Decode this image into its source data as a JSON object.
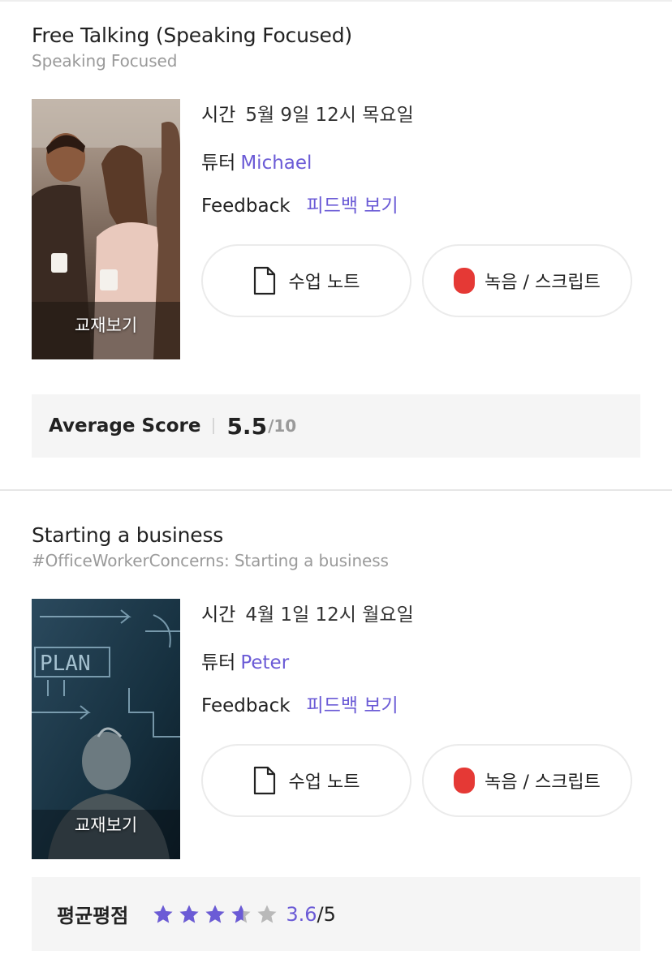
{
  "lessons": [
    {
      "title": "Free Talking (Speaking Focused)",
      "subtitle": "Speaking Focused",
      "thumb_label": "교재보기",
      "time_key": "시간",
      "time_value": "5월  9일 12시 목요일",
      "tutor_key": "튜터",
      "tutor_name": "Michael",
      "feedback_key": "Feedback",
      "feedback_link": "피드백 보기",
      "notes_button": "수업 노트",
      "recording_button": "녹음 / 스크립트",
      "score_label": "Average Score",
      "score_value": "5.5",
      "score_max": "/10"
    },
    {
      "title": "Starting a business",
      "subtitle": "#OfficeWorkerConcerns: Starting a business",
      "thumb_label": "교재보기",
      "time_key": "시간",
      "time_value": "4월  1일 12시 월요일",
      "tutor_key": "튜터",
      "tutor_name": "Peter",
      "feedback_key": "Feedback",
      "feedback_link": "피드백 보기",
      "notes_button": "수업 노트",
      "recording_button": "녹음 / 스크립트",
      "rating_label": "평균평점",
      "rating_value": "3.6",
      "rating_max": "/5",
      "rating_stars": 3.6
    }
  ],
  "colors": {
    "accent": "#6b5bd6",
    "record": "#e53935",
    "star_filled": "#6b5bd6",
    "star_empty": "#b9b9b9",
    "score_bg": "#f5f5f5"
  },
  "icons": {
    "notes": "document-icon",
    "recording": "record-icon",
    "star": "star-icon"
  }
}
